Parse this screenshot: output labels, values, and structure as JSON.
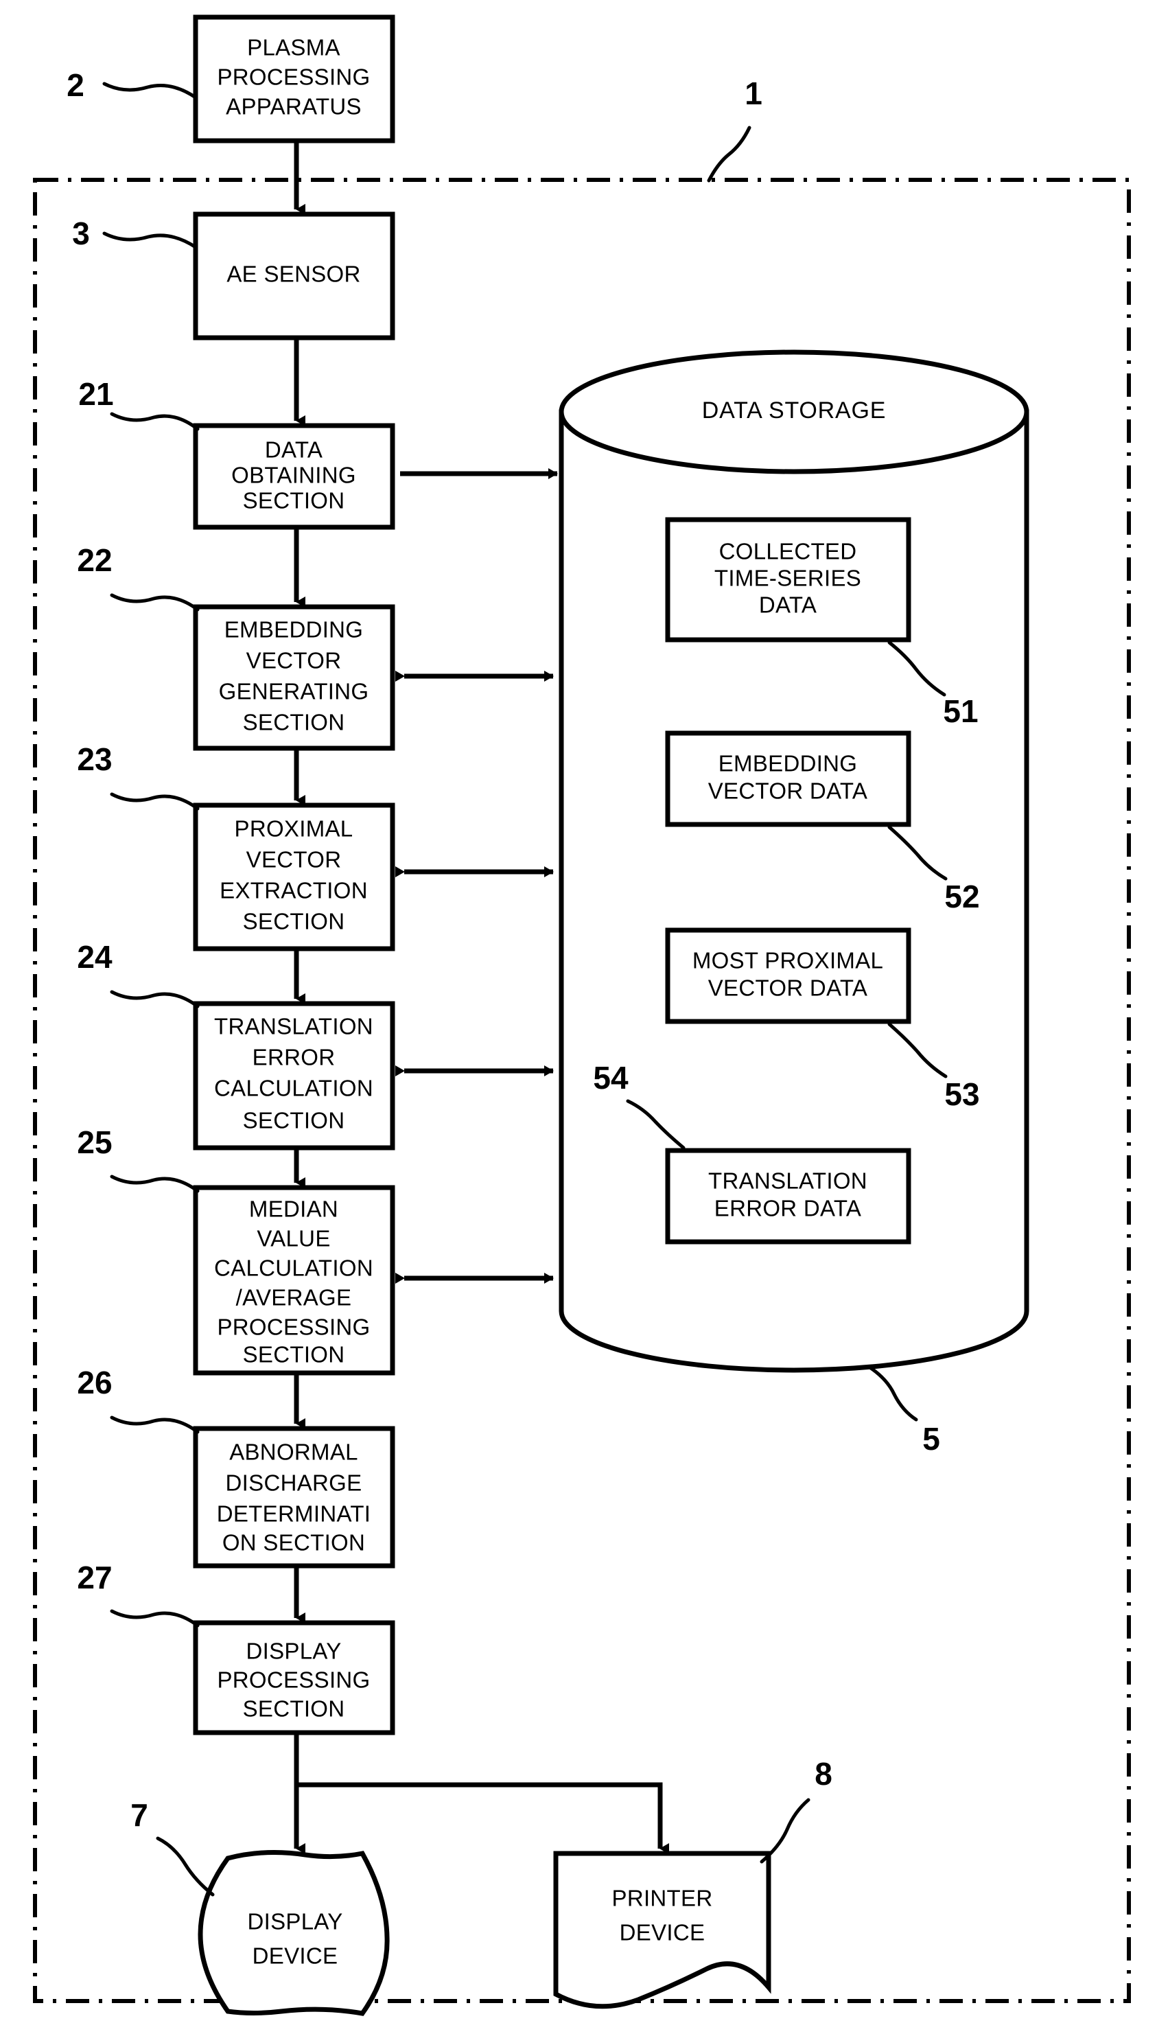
{
  "figure": {
    "system_ref": "1",
    "frame_style": "dash-dot enclosure"
  },
  "blocks": [
    {
      "id": "plasma",
      "ref": "2",
      "lines": [
        "PLASMA",
        "PROCESSING",
        "APPARATUS"
      ],
      "shape": "rect"
    },
    {
      "id": "ae-sensor",
      "ref": "3",
      "lines": [
        "AE SENSOR"
      ],
      "shape": "rect"
    },
    {
      "id": "data-obtaining",
      "ref": "21",
      "lines": [
        "DATA",
        "OBTAINING",
        "SECTION"
      ],
      "shape": "rect"
    },
    {
      "id": "embedding-vector-generating",
      "ref": "22",
      "lines": [
        "EMBEDDING",
        "VECTOR",
        "GENERATING",
        "SECTION"
      ],
      "shape": "rect"
    },
    {
      "id": "proximal-vector-extraction",
      "ref": "23",
      "lines": [
        "PROXIMAL",
        "VECTOR",
        "EXTRACTION",
        "SECTION"
      ],
      "shape": "rect"
    },
    {
      "id": "translation-error-calculation",
      "ref": "24",
      "lines": [
        "TRANSLATION",
        "ERROR",
        "CALCULATION",
        "SECTION"
      ],
      "shape": "rect"
    },
    {
      "id": "median-value-calculation",
      "ref": "25",
      "lines": [
        "MEDIAN",
        "VALUE",
        "CALCULATION",
        "/AVERAGE",
        "PROCESSING",
        "SECTION"
      ],
      "shape": "rect"
    },
    {
      "id": "abnormal-discharge-determination",
      "ref": "26",
      "lines": [
        "ABNORMAL",
        "DISCHARGE",
        "DETERMINATI",
        "ON SECTION"
      ],
      "shape": "rect"
    },
    {
      "id": "display-processing",
      "ref": "27",
      "lines": [
        "DISPLAY",
        "PROCESSING",
        "SECTION"
      ],
      "shape": "rect"
    },
    {
      "id": "display-device",
      "ref": "7",
      "lines": [
        "DISPLAY",
        "DEVICE"
      ],
      "shape": "display"
    },
    {
      "id": "printer-device",
      "ref": "8",
      "lines": [
        "PRINTER",
        "DEVICE"
      ],
      "shape": "document"
    }
  ],
  "storage": {
    "ref": "5",
    "title": "DATA STORAGE",
    "shape": "cylinder",
    "items": [
      {
        "ref": "51",
        "lines": [
          "COLLECTED",
          "TIME-SERIES",
          "DATA"
        ]
      },
      {
        "ref": "52",
        "lines": [
          "EMBEDDING",
          "VECTOR DATA"
        ]
      },
      {
        "ref": "53",
        "lines": [
          "MOST PROXIMAL",
          "VECTOR DATA"
        ]
      },
      {
        "ref": "54",
        "lines": [
          "TRANSLATION",
          "ERROR DATA"
        ]
      }
    ]
  },
  "colors": {
    "ink": "#000000",
    "paper": "#ffffff"
  }
}
